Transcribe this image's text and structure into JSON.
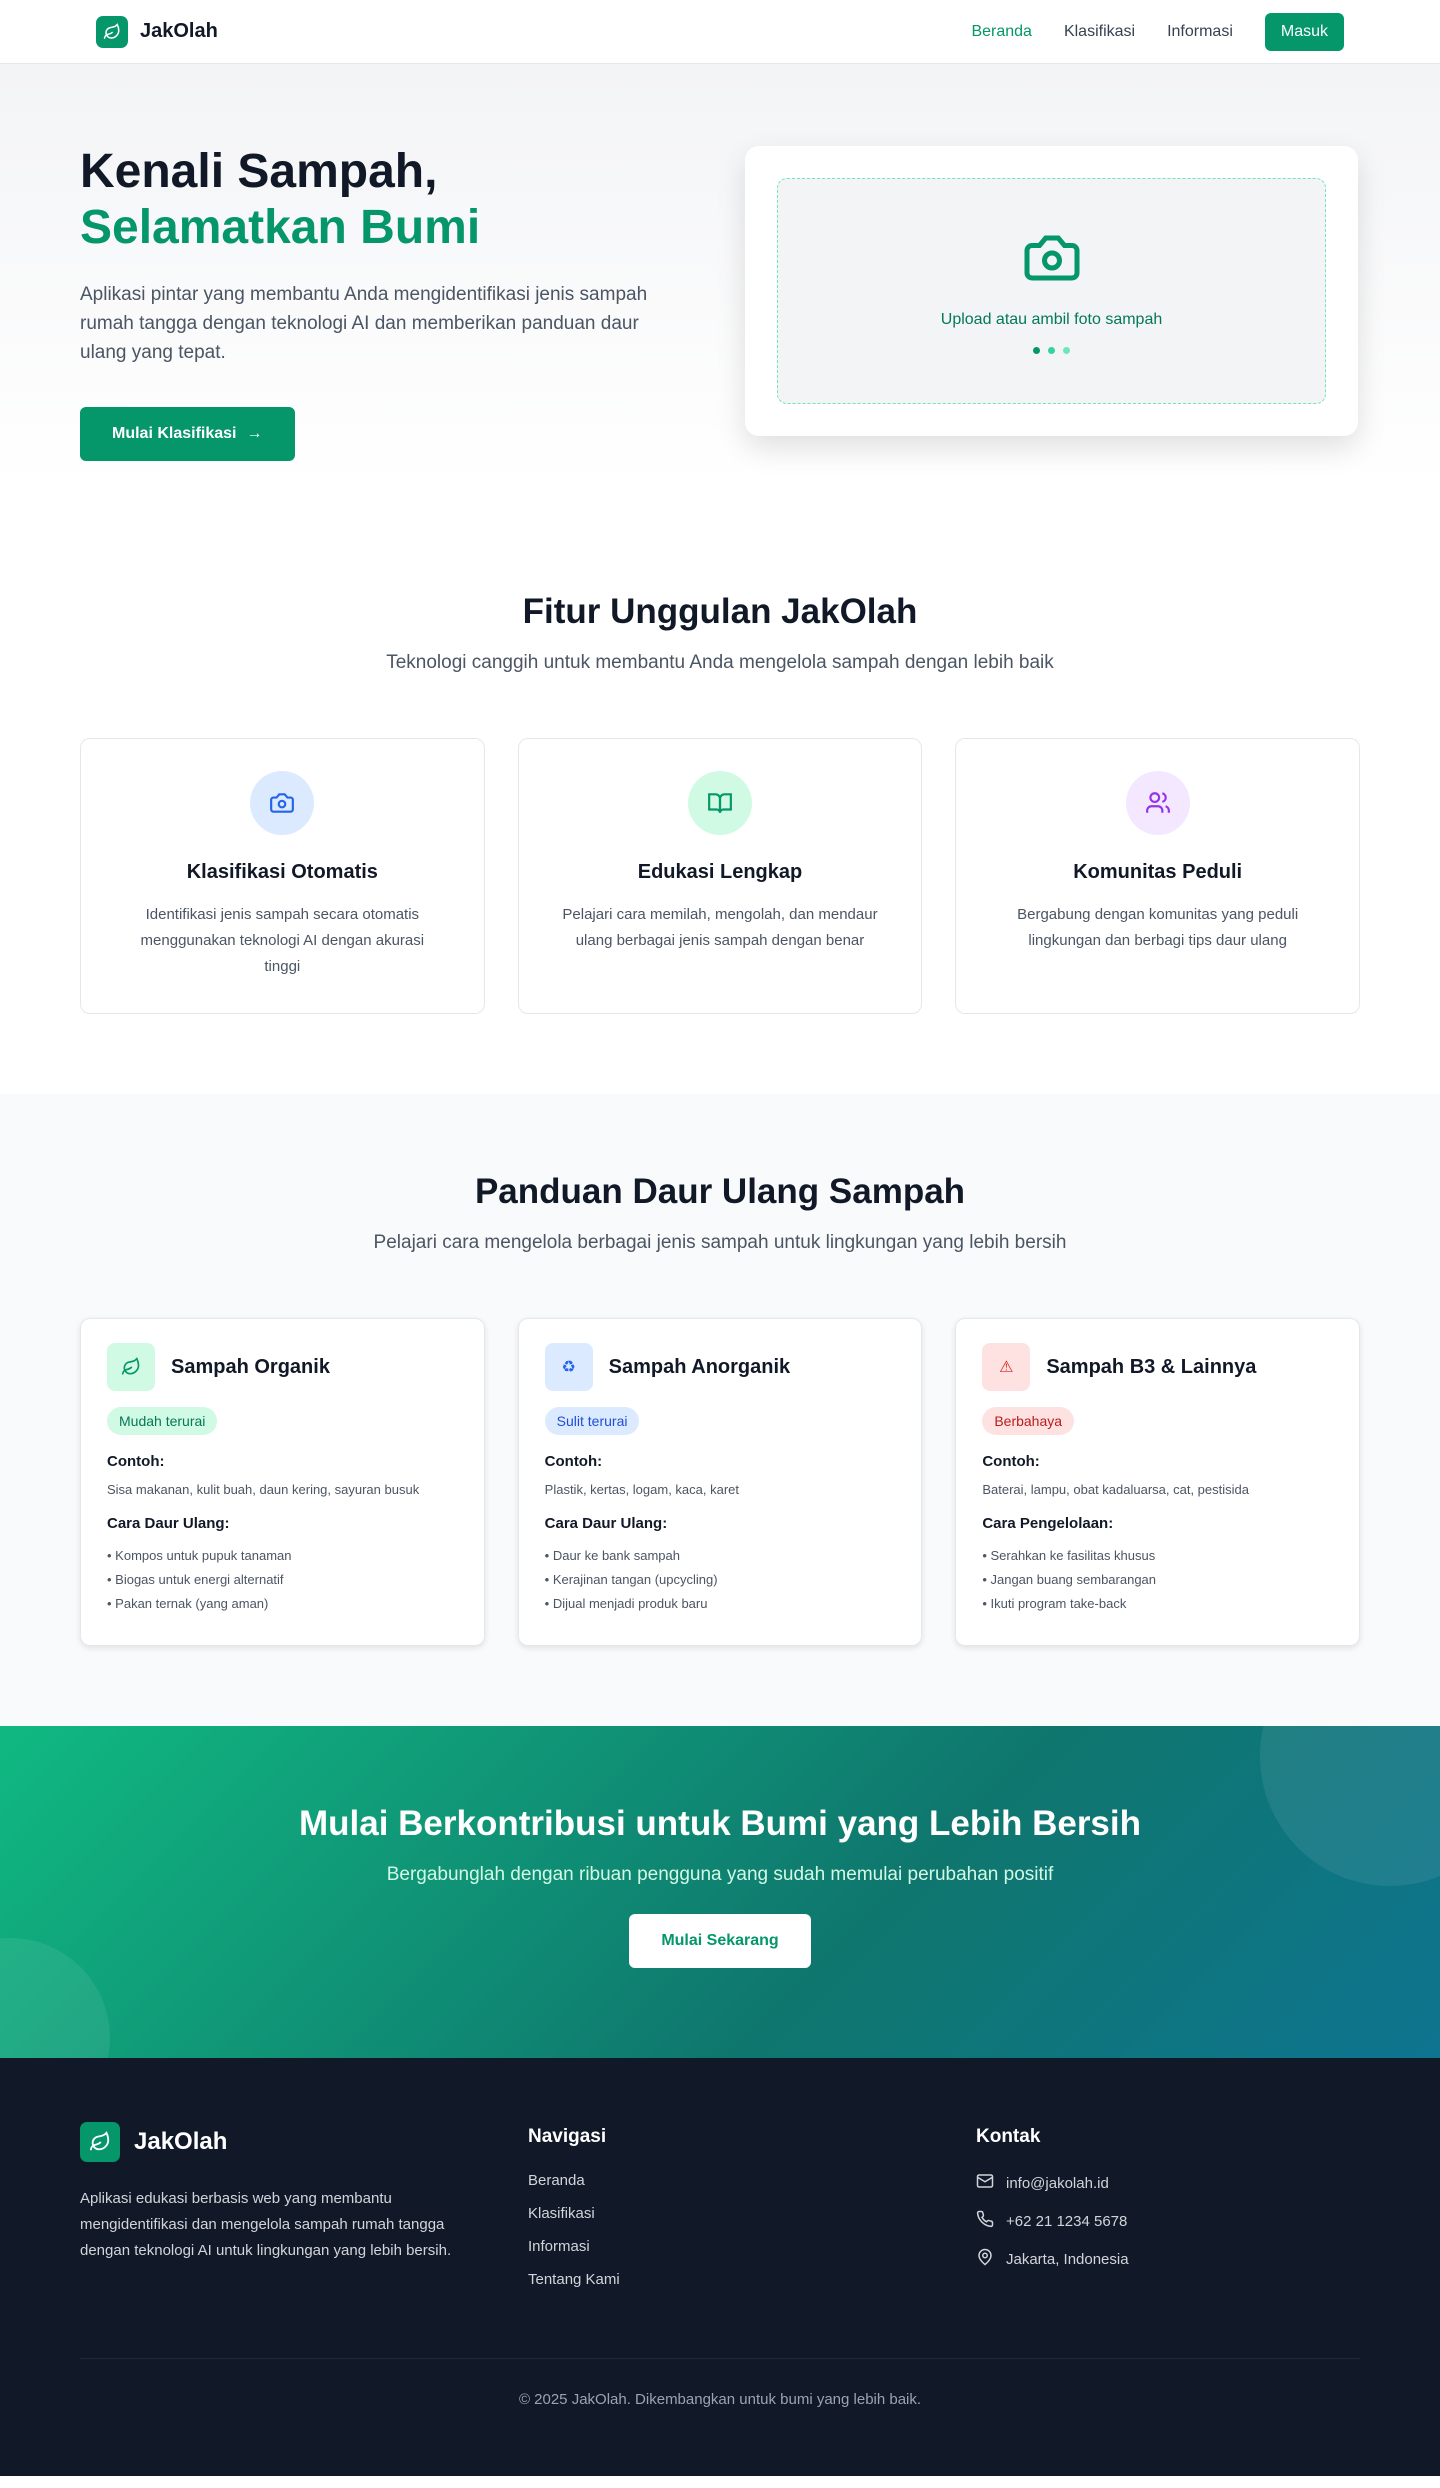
{
  "nav": {
    "brand": "JakOlah",
    "links": [
      "Beranda",
      "Klasifikasi",
      "Informasi"
    ],
    "login": "Masuk"
  },
  "hero": {
    "title_1": "Kenali Sampah,",
    "title_2": "Selamatkan Bumi",
    "desc": "Aplikasi pintar yang membantu Anda mengidentifikasi jenis sampah rumah tangga dengan teknologi AI dan memberikan panduan daur ulang yang tepat.",
    "cta": "Mulai Klasifikasi",
    "upload_text": "Upload atau ambil foto sampah"
  },
  "features": {
    "title": "Fitur Unggulan JakOlah",
    "subtitle": "Teknologi canggih untuk membantu Anda mengelola sampah dengan lebih baik",
    "items": [
      {
        "icon": "camera-icon",
        "title": "Klasifikasi Otomatis",
        "desc": "Identifikasi jenis sampah secara otomatis menggunakan teknologi AI dengan akurasi tinggi"
      },
      {
        "icon": "book-open-icon",
        "title": "Edukasi Lengkap",
        "desc": "Pelajari cara memilah, mengolah, dan mendaur ulang berbagai jenis sampah dengan benar"
      },
      {
        "icon": "users-icon",
        "title": "Komunitas Peduli",
        "desc": "Bergabung dengan komunitas yang peduli lingkungan dan berbagi tips daur ulang"
      }
    ]
  },
  "guide": {
    "title": "Panduan Daur Ulang Sampah",
    "subtitle": "Pelajari cara mengelola berbagai jenis sampah untuk lingkungan yang lebih bersih",
    "cards": [
      {
        "title": "Sampah Organik",
        "icon": "leaf-icon",
        "badge": "Mudah terurai",
        "examples_label": "Contoh:",
        "examples": "Sisa makanan, kulit buah, daun kering, sayuran busuk",
        "method_label": "Cara Daur Ulang:",
        "methods": [
          "• Kompos untuk pupuk tanaman",
          "• Biogas untuk energi alternatif",
          "• Pakan ternak (yang aman)"
        ]
      },
      {
        "title": "Sampah Anorganik",
        "icon": "recycle-icon",
        "badge": "Sulit terurai",
        "examples_label": "Contoh:",
        "examples": "Plastik, kertas, logam, kaca, karet",
        "method_label": "Cara Daur Ulang:",
        "methods": [
          "• Daur ke bank sampah",
          "• Kerajinan tangan (upcycling)",
          "• Dijual menjadi produk baru"
        ]
      },
      {
        "title": "Sampah B3 & Lainnya",
        "icon": "warning-icon",
        "badge": "Berbahaya",
        "examples_label": "Contoh:",
        "examples": "Baterai, lampu, obat kadaluarsa, cat, pestisida",
        "method_label": "Cara Pengelolaan:",
        "methods": [
          "• Serahkan ke fasilitas khusus",
          "• Jangan buang sembarangan",
          "• Ikuti program take-back"
        ]
      }
    ]
  },
  "cta": {
    "title": "Mulai Berkontribusi untuk Bumi yang Lebih Bersih",
    "subtitle": "Bergabunglah dengan ribuan pengguna yang sudah memulai perubahan positif",
    "button": "Mulai Sekarang"
  },
  "footer": {
    "brand": "JakOlah",
    "desc": "Aplikasi edukasi berbasis web yang membantu mengidentifikasi dan mengelola sampah rumah tangga dengan teknologi AI untuk lingkungan yang lebih bersih.",
    "nav_title": "Navigasi",
    "nav_links": [
      "Beranda",
      "Klasifikasi",
      "Informasi",
      "Tentang Kami"
    ],
    "contact_title": "Kontak",
    "email": "info@jakolah.id",
    "phone": "+62 21 1234 5678",
    "location": "Jakarta, Indonesia",
    "copyright": "© 2025 JakOlah. Dikembangkan untuk bumi yang lebih baik."
  },
  "colors": {
    "primary": "#059669",
    "dark": "#111827"
  }
}
